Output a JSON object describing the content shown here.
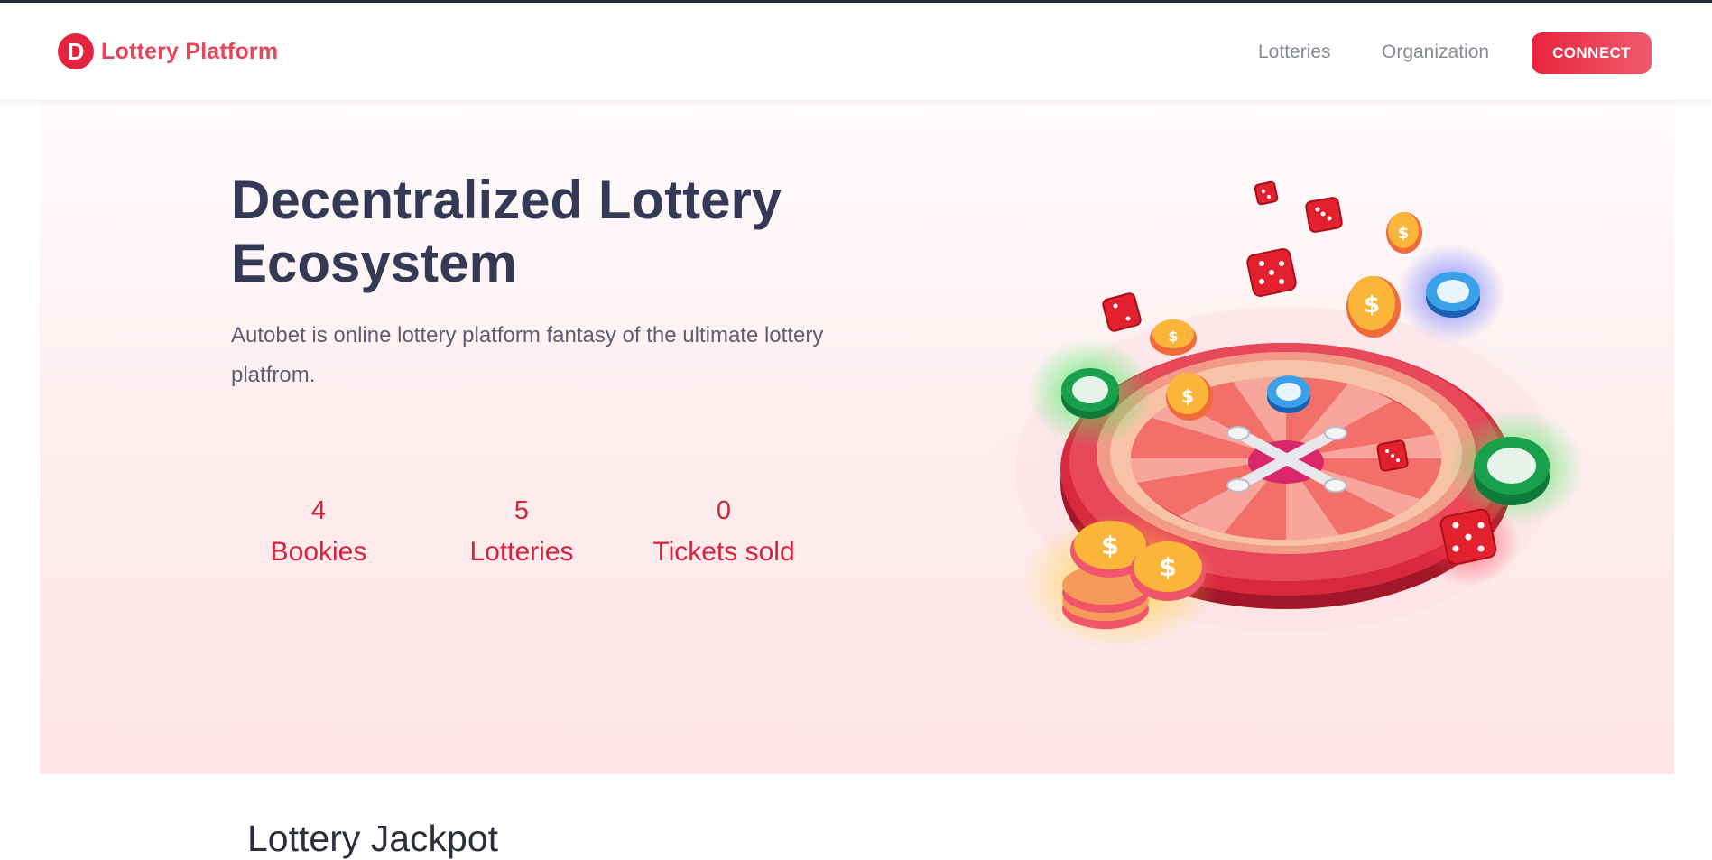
{
  "brand": {
    "logo_letter": "D",
    "name": "Lottery Platform"
  },
  "nav": {
    "links": [
      {
        "label": "Lotteries"
      },
      {
        "label": "Organization"
      }
    ],
    "connect_label": "CONNECT"
  },
  "hero": {
    "title": "Decentralized Lottery Ecosystem",
    "description": "Autobet is online lottery platform fantasy of the ultimate lottery platfrom.",
    "stats": [
      {
        "value": "4",
        "label": "Bookies"
      },
      {
        "value": "5",
        "label": "Lotteries"
      },
      {
        "value": "0",
        "label": "Tickets sold"
      }
    ],
    "illustration": "roulette-wheel-dice-chips-illustration"
  },
  "section": {
    "title": "Lottery Jackpot"
  },
  "colors": {
    "accent": "#e3243e",
    "heading": "#343a55",
    "body_text": "#5b6070",
    "hero_bg": "#fde8ea"
  }
}
